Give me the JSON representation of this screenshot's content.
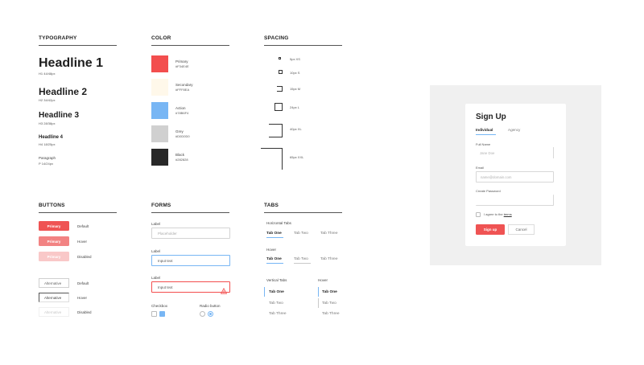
{
  "sections": {
    "typography": "TYPOGRAPHY",
    "color": "COLOR",
    "spacing": "SPACING",
    "buttons": "BUTTONS",
    "forms": "FORMS",
    "tabs": "TABS"
  },
  "typography": [
    {
      "label": "Headline 1",
      "spec": "H1 44/48px"
    },
    {
      "label": "Headline 2",
      "spec": "H2 34/42px"
    },
    {
      "label": "Headline 3",
      "spec": "H3 28/38px"
    },
    {
      "label": "Headline 4",
      "spec": "H4 18/25px"
    },
    {
      "label": "Paragraph",
      "spec": "P 14/24px"
    }
  ],
  "colors": [
    {
      "name": "Primary",
      "hex": "#F34E4E",
      "value": "#f34e4e"
    },
    {
      "name": "Secondary",
      "hex": "#FFF8EA",
      "value": "#fff8ea"
    },
    {
      "name": "Action",
      "hex": "#78B6F4",
      "value": "#78b6f4"
    },
    {
      "name": "Grey",
      "hex": "#D0D0D0",
      "value": "#d0d0d0"
    },
    {
      "name": "Black",
      "hex": "#282828",
      "value": "#282828"
    }
  ],
  "spacing": [
    {
      "label": "5px XS"
    },
    {
      "label": "10px S"
    },
    {
      "label": "15px M"
    },
    {
      "label": "24px L"
    },
    {
      "label": "40px XL"
    },
    {
      "label": "65px XXL"
    }
  ],
  "buttons": {
    "filled": [
      {
        "label": "Primary",
        "state": "Default",
        "color": "#ef5353"
      },
      {
        "label": "Primary",
        "state": "Hover",
        "color": "#f28383"
      },
      {
        "label": "Primary",
        "state": "Disabled",
        "color": "#f9c8c8"
      }
    ],
    "outline": [
      {
        "label": "Alternative",
        "state": "Default"
      },
      {
        "label": "Alternative",
        "state": "Hover"
      },
      {
        "label": "Alternative",
        "state": "Disabled"
      }
    ]
  },
  "forms": {
    "fields": [
      {
        "label": "Label",
        "value": "Placeholder"
      },
      {
        "label": "Label",
        "value": "Input text"
      },
      {
        "label": "Label",
        "value": "Input text"
      }
    ],
    "checkbox_label": "Checkbox",
    "radio_label": "Radio button",
    "error_icon": "warning-icon"
  },
  "tabs": {
    "horizontal_title": "Horizontal Tabs",
    "hover_title": "Hover",
    "vertical_title": "Vertical Tabs",
    "vertical_hover_title": "Hover",
    "items": [
      "Tab One",
      "Tab Two",
      "Tab Three"
    ]
  },
  "card": {
    "title": "Sign Up",
    "tabs": [
      "Individual",
      "Agency"
    ],
    "full_name_label": "Full Name",
    "full_name_placeholder": "Jane Doe",
    "email_label": "Email",
    "email_placeholder": "name@domain.com",
    "password_label": "Create Password",
    "agree_text": "I agree to the",
    "terms_link": "terms",
    "signup_label": "Sign up",
    "cancel_label": "Cancel"
  },
  "accent": "#78b6f4",
  "primary": "#f34e4e"
}
